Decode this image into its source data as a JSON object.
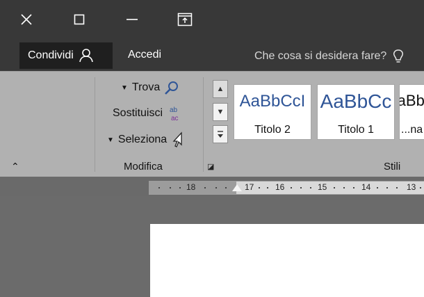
{
  "titlebar": {
    "close_icon": "close-icon",
    "restore_icon": "restore-icon",
    "minimize_icon": "minimize-icon",
    "ribbon_options_icon": "ribbon-display-options-icon"
  },
  "tellbar": {
    "share_label": "Condividi",
    "login_label": "Accedi",
    "tell_me_placeholder": "Che cosa si desidera fare?"
  },
  "ribbon": {
    "editing": {
      "find_label": "Trova",
      "replace_label": "Sostituisci",
      "select_label": "Seleziona",
      "group_label": "Modifica"
    },
    "styles": {
      "group_label": "Stili",
      "tiles": [
        {
          "preview": "AaBbCcI",
          "name": "Titolo 2"
        },
        {
          "preview": "AaBbCc",
          "name": "Titolo 1"
        },
        {
          "preview": "AaBbCcDc",
          "name": "...na"
        }
      ]
    }
  },
  "ruler": {
    "numbers": [
      "18",
      "17",
      "16",
      "15",
      "14",
      "13"
    ]
  },
  "colors": {
    "titlebar": "#383838",
    "ribbon": "#b1b1b1",
    "style_preview": "#2f5597"
  }
}
